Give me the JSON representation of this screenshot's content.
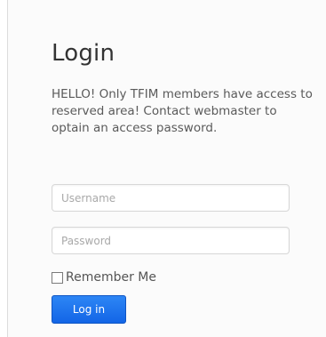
{
  "login": {
    "title": "Login",
    "intro": "HELLO! Only TFIM members have access to reserved area! Contact webmaster to optain an access password.",
    "username_placeholder": "Username",
    "password_placeholder": "Password",
    "remember_label": "Remember Me",
    "remember_checked": false,
    "submit_label": "Log in"
  },
  "colors": {
    "button": "#1d74ec",
    "text": "#5a5a5a",
    "title": "#333333"
  }
}
